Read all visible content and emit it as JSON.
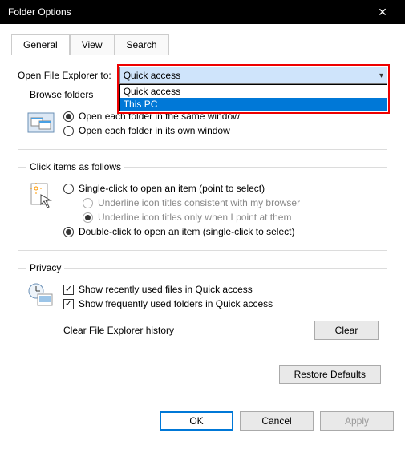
{
  "window": {
    "title": "Folder Options"
  },
  "tabs": [
    {
      "label": "General",
      "active": true
    },
    {
      "label": "View",
      "active": false
    },
    {
      "label": "Search",
      "active": false
    }
  ],
  "openExplorer": {
    "label": "Open File Explorer to:",
    "selected": "Quick access",
    "options": [
      "Quick access",
      "This PC"
    ],
    "highlightIndex": 1
  },
  "browse": {
    "legend": "Browse folders",
    "opt_same": "Open each folder in the same window",
    "opt_own": "Open each folder in its own window",
    "selected": "same"
  },
  "click": {
    "legend": "Click items as follows",
    "single": "Single-click to open an item (point to select)",
    "underline_browser": "Underline icon titles consistent with my browser",
    "underline_point": "Underline icon titles only when I point at them",
    "double": "Double-click to open an item (single-click to select)",
    "selected": "double"
  },
  "privacy": {
    "legend": "Privacy",
    "recent": "Show recently used files in Quick access",
    "frequent": "Show frequently used folders in Quick access",
    "recent_on": true,
    "frequent_on": true,
    "clear_label": "Clear File Explorer history",
    "clear_btn": "Clear"
  },
  "restore": "Restore Defaults",
  "footer": {
    "ok": "OK",
    "cancel": "Cancel",
    "apply": "Apply"
  }
}
